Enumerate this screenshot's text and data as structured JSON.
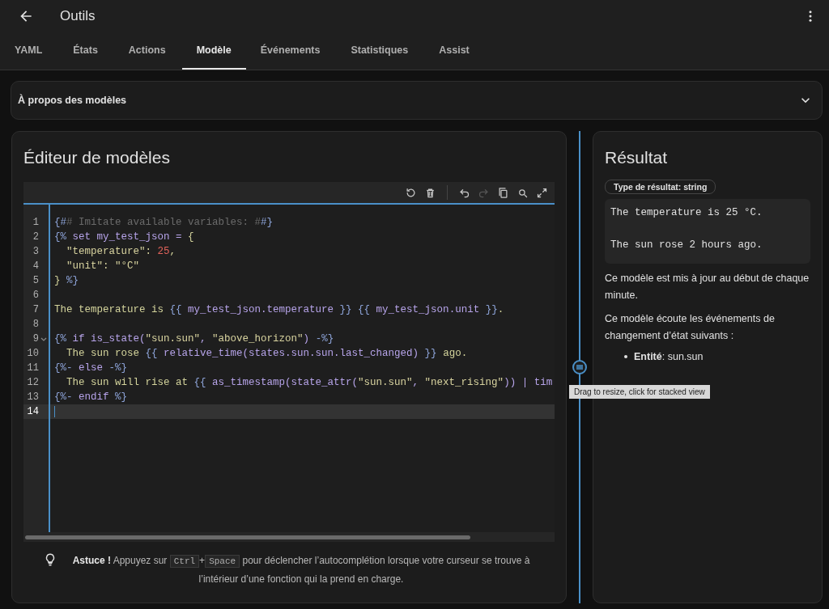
{
  "header": {
    "title": "Outils"
  },
  "tabs": [
    {
      "label": "YAML",
      "selected": false
    },
    {
      "label": "États",
      "selected": false
    },
    {
      "label": "Actions",
      "selected": false
    },
    {
      "label": "Modèle",
      "selected": true
    },
    {
      "label": "Événements",
      "selected": false
    },
    {
      "label": "Statistiques",
      "selected": false
    },
    {
      "label": "Assist",
      "selected": false
    }
  ],
  "about": {
    "label": "À propos des modèles",
    "expanded": false
  },
  "editor": {
    "title": "Éditeur de modèles",
    "toolbar": [
      {
        "kind": "reset",
        "disabled": false
      },
      {
        "kind": "delete",
        "disabled": false
      },
      {
        "kind": "undo",
        "disabled": false
      },
      {
        "kind": "redo",
        "disabled": true
      },
      {
        "kind": "copy",
        "disabled": false
      },
      {
        "kind": "search",
        "disabled": false
      },
      {
        "kind": "fullscreen",
        "disabled": false
      }
    ],
    "lines": [
      {
        "number": "1",
        "foldable": false,
        "active": false,
        "tokens": [
          {
            "kind": "delim",
            "text": "{#"
          },
          {
            "kind": "comment",
            "text": "# Imitate available variables: #"
          },
          {
            "kind": "delim",
            "text": "#}"
          }
        ]
      },
      {
        "number": "2",
        "foldable": false,
        "active": false,
        "tokens": [
          {
            "kind": "delim",
            "text": "{%"
          },
          {
            "kind": "code",
            "text": " set my_test_json = "
          },
          {
            "kind": "text",
            "text": "{"
          }
        ]
      },
      {
        "number": "3",
        "foldable": false,
        "active": false,
        "tokens": [
          {
            "kind": "str",
            "text": "  \"temperature\": "
          },
          {
            "kind": "num",
            "text": "25"
          },
          {
            "kind": "text",
            "text": ","
          }
        ]
      },
      {
        "number": "4",
        "foldable": false,
        "active": false,
        "tokens": [
          {
            "kind": "str",
            "text": "  \"unit\": \"°C\""
          }
        ]
      },
      {
        "number": "5",
        "foldable": false,
        "active": false,
        "tokens": [
          {
            "kind": "text",
            "text": "} "
          },
          {
            "kind": "delim",
            "text": "%}"
          }
        ]
      },
      {
        "number": "6",
        "foldable": false,
        "active": false
      },
      {
        "number": "7",
        "foldable": false,
        "active": false,
        "tokens": [
          {
            "kind": "text",
            "text": "The temperature is "
          },
          {
            "kind": "delim",
            "text": "{{"
          },
          {
            "kind": "code",
            "text": " my_test_json.temperature "
          },
          {
            "kind": "delim",
            "text": "}} {{"
          },
          {
            "kind": "code",
            "text": " my_test_json.unit "
          },
          {
            "kind": "delim",
            "text": "}}"
          },
          {
            "kind": "text",
            "text": "."
          }
        ]
      },
      {
        "number": "8",
        "foldable": false,
        "active": false
      },
      {
        "number": "9",
        "foldable": true,
        "active": false,
        "tokens": [
          {
            "kind": "delim",
            "text": "{%"
          },
          {
            "kind": "code",
            "text": " if is_state("
          },
          {
            "kind": "str",
            "text": "\"sun.sun\""
          },
          {
            "kind": "code",
            "text": ", "
          },
          {
            "kind": "str",
            "text": "\"above_horizon\""
          },
          {
            "kind": "code",
            "text": ") "
          },
          {
            "kind": "delim",
            "text": "-%}"
          }
        ]
      },
      {
        "number": "10",
        "foldable": false,
        "active": false,
        "tokens": [
          {
            "kind": "text",
            "text": "  The sun rose "
          },
          {
            "kind": "delim",
            "text": "{{"
          },
          {
            "kind": "code",
            "text": " relative_time(states.sun.sun.last_changed) "
          },
          {
            "kind": "delim",
            "text": "}}"
          },
          {
            "kind": "text",
            "text": " ago."
          }
        ]
      },
      {
        "number": "11",
        "foldable": false,
        "active": false,
        "tokens": [
          {
            "kind": "delim",
            "text": "{%-"
          },
          {
            "kind": "code",
            "text": " else "
          },
          {
            "kind": "delim",
            "text": "-%}"
          }
        ]
      },
      {
        "number": "12",
        "foldable": false,
        "active": false,
        "tokens": [
          {
            "kind": "text",
            "text": "  The sun will rise at "
          },
          {
            "kind": "delim",
            "text": "{{"
          },
          {
            "kind": "code",
            "text": " as_timestamp(state_attr("
          },
          {
            "kind": "str",
            "text": "\"sun.sun\""
          },
          {
            "kind": "code",
            "text": ", "
          },
          {
            "kind": "str",
            "text": "\"next_rising\""
          },
          {
            "kind": "code",
            "text": ")) | tim"
          }
        ]
      },
      {
        "number": "13",
        "foldable": false,
        "active": false,
        "tokens": [
          {
            "kind": "delim",
            "text": "{%-"
          },
          {
            "kind": "code",
            "text": " endif "
          },
          {
            "kind": "delim",
            "text": "%}"
          }
        ]
      },
      {
        "number": "14",
        "foldable": false,
        "active": true
      }
    ],
    "hint": [
      {
        "kind": "bold",
        "text": "Astuce !"
      },
      {
        "kind": "text",
        "text": "Appuyez sur"
      },
      {
        "kind": "key",
        "text": "Ctrl"
      },
      {
        "kind": "plus",
        "text": "+"
      },
      {
        "kind": "key",
        "text": "Space"
      },
      {
        "kind": "text",
        "text": "pour déclencher l’autocomplétion lorsque votre curseur se trouve à l’intérieur d’une fonction qui la prend en charge."
      }
    ]
  },
  "divider": {
    "tooltip": "Drag to resize, click for stacked view"
  },
  "result": {
    "title": "Résultat",
    "type_chip": "Type de résultat: string",
    "output": [
      "The temperature is 25 °C.",
      "The sun rose 2 hours ago."
    ],
    "notes": [
      "Ce modèle est mis à jour au début de chaque minute.",
      "Ce modèle écoute les événements de changement d’état suivants :"
    ],
    "listeners": [
      "**Entité**: sun.sun"
    ]
  }
}
